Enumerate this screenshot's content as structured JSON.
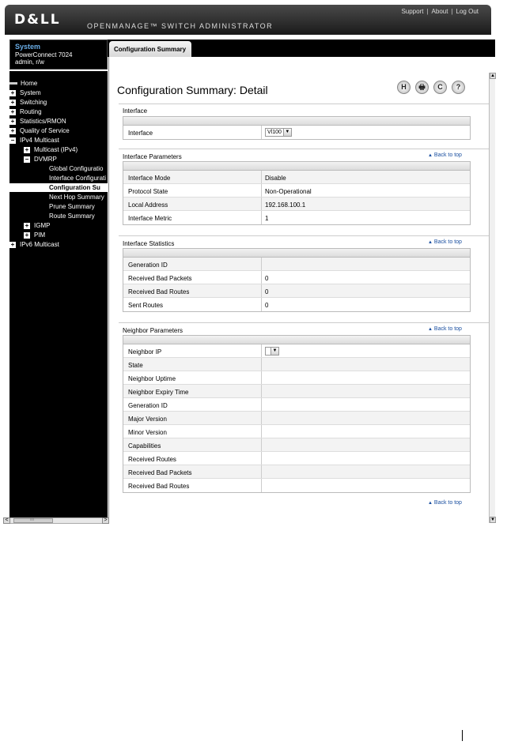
{
  "header": {
    "logo": "D&LL",
    "app_title": "OPENMANAGE™ SWITCH ADMINISTRATOR",
    "links": [
      "Support",
      "About",
      "Log Out"
    ],
    "separator": "|"
  },
  "system": {
    "title": "System",
    "model": "PowerConnect 7024",
    "user": "admin, r/w"
  },
  "tab": {
    "label": "Configuration Summary"
  },
  "nav": {
    "items": [
      {
        "label": "Home",
        "marker": "dash",
        "indent": 0,
        "selected": false
      },
      {
        "label": "System",
        "marker": "+",
        "indent": 0,
        "selected": false
      },
      {
        "label": "Switching",
        "marker": "+",
        "indent": 0,
        "selected": false
      },
      {
        "label": "Routing",
        "marker": "+",
        "indent": 0,
        "selected": false
      },
      {
        "label": "Statistics/RMON",
        "marker": "+",
        "indent": 0,
        "selected": false
      },
      {
        "label": "Quality of Service",
        "marker": "+",
        "indent": 0,
        "selected": false
      },
      {
        "label": "IPv4 Multicast",
        "marker": "−",
        "indent": 0,
        "selected": false
      },
      {
        "label": "Multicast (IPv4)",
        "marker": "+",
        "indent": 1,
        "selected": false
      },
      {
        "label": "DVMRP",
        "marker": "−",
        "indent": 1,
        "selected": false
      },
      {
        "label": "Global Configuratio",
        "marker": "",
        "indent": 2,
        "selected": false
      },
      {
        "label": "Interface Configurati",
        "marker": "",
        "indent": 2,
        "selected": false
      },
      {
        "label": "Configuration Su",
        "marker": "",
        "indent": 2,
        "selected": true
      },
      {
        "label": "Next Hop Summary",
        "marker": "",
        "indent": 2,
        "selected": false
      },
      {
        "label": "Prune Summary",
        "marker": "",
        "indent": 2,
        "selected": false
      },
      {
        "label": "Route Summary",
        "marker": "",
        "indent": 2,
        "selected": false
      },
      {
        "label": "IGMP",
        "marker": "+",
        "indent": 1,
        "selected": false
      },
      {
        "label": "PIM",
        "marker": "+",
        "indent": 1,
        "selected": false
      },
      {
        "label": "IPv6 Multicast",
        "marker": "+",
        "indent": 0,
        "selected": false
      }
    ]
  },
  "page": {
    "title": "Configuration Summary: Detail",
    "tools": [
      {
        "icon": "save-icon",
        "glyph": "H"
      },
      {
        "icon": "print-icon",
        "glyph": "🖶"
      },
      {
        "icon": "refresh-icon",
        "glyph": "C"
      },
      {
        "icon": "help-icon",
        "glyph": "?"
      }
    ],
    "back_to_top": "Back to top"
  },
  "interface": {
    "title": "Interface",
    "label": "Interface",
    "selected": "Vl100"
  },
  "interface_parameters": {
    "title": "Interface Parameters",
    "rows": [
      {
        "label": "Interface Mode",
        "value": "Disable"
      },
      {
        "label": "Protocol State",
        "value": "Non-Operational"
      },
      {
        "label": "Local Address",
        "value": "192.168.100.1"
      },
      {
        "label": "Interface Metric",
        "value": "1"
      }
    ]
  },
  "interface_statistics": {
    "title": "Interface Statistics",
    "rows": [
      {
        "label": "Generation ID",
        "value": ""
      },
      {
        "label": "Received Bad Packets",
        "value": "0"
      },
      {
        "label": "Received Bad Routes",
        "value": "0"
      },
      {
        "label": "Sent Routes",
        "value": "0"
      }
    ]
  },
  "neighbor_parameters": {
    "title": "Neighbor Parameters",
    "neighbor_ip_label": "Neighbor IP",
    "neighbor_ip_selected": "",
    "rows": [
      {
        "label": "State",
        "value": ""
      },
      {
        "label": "Neighbor Uptime",
        "value": ""
      },
      {
        "label": "Neighbor Expiry Time",
        "value": ""
      },
      {
        "label": "Generation ID",
        "value": ""
      },
      {
        "label": "Major Version",
        "value": ""
      },
      {
        "label": "Minor Version",
        "value": ""
      },
      {
        "label": "Capabilities",
        "value": ""
      },
      {
        "label": "Received Routes",
        "value": ""
      },
      {
        "label": "Received Bad Packets",
        "value": ""
      },
      {
        "label": "Received Bad Routes",
        "value": ""
      }
    ]
  },
  "scrollbar": {
    "grip": "III"
  }
}
